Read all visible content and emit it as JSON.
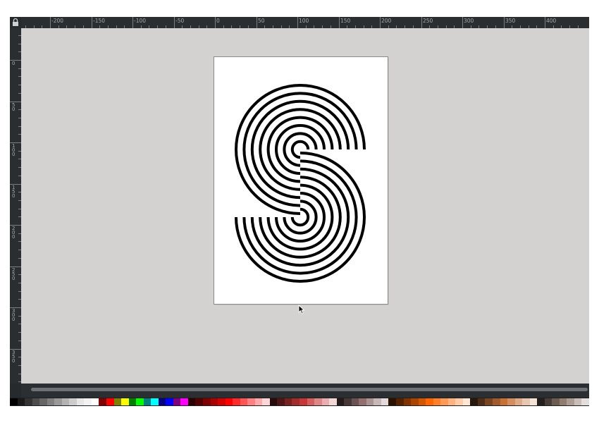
{
  "rulers": {
    "horizontal_labels": [
      "-200",
      "-150",
      "-100",
      "-50",
      "0",
      "50",
      "100",
      "150",
      "200",
      "250",
      "300",
      "350",
      "400"
    ],
    "vertical_labels": [
      "0",
      "50",
      "100",
      "150",
      "200",
      "250",
      "300",
      "350"
    ]
  },
  "icons": {
    "lock": "lock-icon",
    "cursor": "mouse-pointer-icon"
  },
  "colors": {
    "window_bg": "#262a2c",
    "canvas_bg": "#d3d2d1",
    "page_bg": "#ffffff",
    "artwork_stroke": "#000000"
  },
  "artwork": {
    "shape": "concentric-spiral-letter-S",
    "ring_count": 8
  },
  "palette": [
    "#000000",
    "#1a1a1a",
    "#333333",
    "#4d4d4d",
    "#666666",
    "#808080",
    "#999999",
    "#b3b3b3",
    "#cccccc",
    "#e6e6e6",
    "#f2f2f2",
    "#ffffff",
    "#800000",
    "#ff0000",
    "#808000",
    "#ffff00",
    "#008000",
    "#00ff00",
    "#008080",
    "#00ffff",
    "#000080",
    "#0000ff",
    "#800080",
    "#ff00ff",
    "#2b0000",
    "#550000",
    "#800000",
    "#aa0000",
    "#d40000",
    "#ff0000",
    "#ff2a2a",
    "#ff5555",
    "#ff8080",
    "#ffaaaa",
    "#ffd5d5",
    "#280b0b",
    "#501616",
    "#782121",
    "#a02c2c",
    "#c83737",
    "#d35f5f",
    "#de8787",
    "#e9afaf",
    "#f4d7d7",
    "#241c1c",
    "#483737",
    "#6c5353",
    "#916f6f",
    "#ac9393",
    "#c8b7b7",
    "#e3dbdb",
    "#2b1100",
    "#552200",
    "#803300",
    "#aa4400",
    "#d45500",
    "#ff6600",
    "#ff7f2a",
    "#ff9955",
    "#ffb380",
    "#ffccaa",
    "#ffe6d5",
    "#28170b",
    "#502d16",
    "#784421",
    "#a05a2c",
    "#c87137",
    "#d38d5f",
    "#deaa87",
    "#e9c6af",
    "#f4e3d7",
    "#241f1c",
    "#483e37",
    "#6c5d53",
    "#917c6f",
    "#ac9d93",
    "#c8beb7",
    "#e3dedb"
  ]
}
